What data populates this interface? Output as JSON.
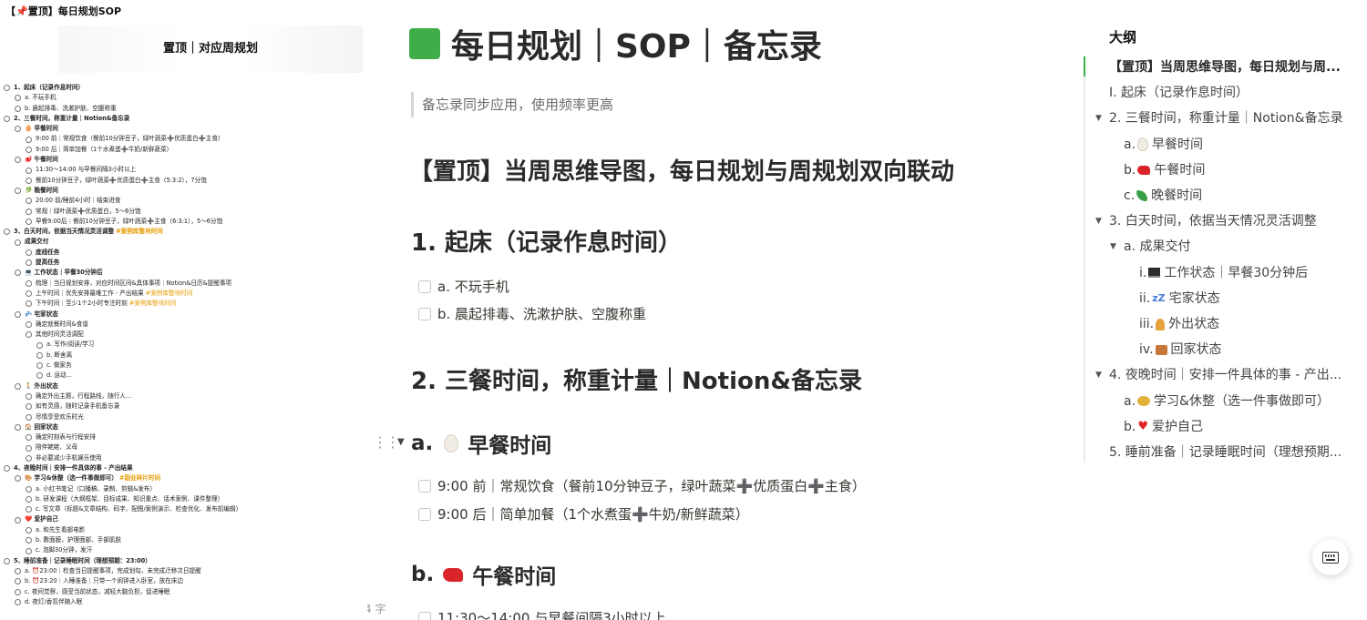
{
  "left_panel": {
    "title": "【📌置顶】每日规划SOP",
    "map_title": "置顶｜对应周规划",
    "items": [
      {
        "text": "1、起床（记录作息时间）",
        "level": 0,
        "bold": true
      },
      {
        "text": "a. 不玩手机",
        "level": 1
      },
      {
        "text": "b. 晨起排毒、洗漱护肤、空腹称重",
        "level": 1
      },
      {
        "text": "2、三餐时间，称重计量｜Notion&备忘录",
        "level": 0,
        "bold": true
      },
      {
        "text": "🥚 早餐时间",
        "level": 1,
        "bold": true
      },
      {
        "text": "9:00 前｜常规饮食（餐前10分钟豆子，绿叶蔬菜➕优质蛋白➕主食）",
        "level": 2
      },
      {
        "text": "9:00 后｜简单加餐（1个水煮蛋➕牛奶/新鲜蔬菜）",
        "level": 2
      },
      {
        "text": "🥩 午餐时间",
        "level": 1,
        "bold": true
      },
      {
        "text": "11:30～14:00 与早餐间隔3小时以上",
        "level": 2
      },
      {
        "text": "餐前10分钟豆子，绿叶蔬菜➕优质蛋白➕主食（5:3:2），7分饱",
        "level": 2
      },
      {
        "text": "🥬 晚餐时间",
        "level": 1,
        "bold": true
      },
      {
        "text": "20:00 前/睡前4小时｜结束进食",
        "level": 2
      },
      {
        "text": "常规｜绿叶蔬菜➕优质蛋白，5～6分饱",
        "level": 2
      },
      {
        "text": "早餐9:00后｜餐前10分钟豆子，绿叶蔬菜➕主食（6:3:1），5～6分饱",
        "level": 2
      },
      {
        "text": "3、白天时间，依据当天情况灵活调整",
        "level": 0,
        "bold": true,
        "tag": "#案例库整块时间"
      },
      {
        "text": "成果交付",
        "level": 1,
        "bold": true
      },
      {
        "text": "底线任务",
        "level": 2,
        "bold": true
      },
      {
        "text": "提高任务",
        "level": 2,
        "bold": true
      },
      {
        "text": "💻 工作状态｜早餐30分钟后",
        "level": 1,
        "bold": true
      },
      {
        "text": "梳理｜当日规划安排，对应时间区间&具体事项｜Notion&日历&提醒事项",
        "level": 2
      },
      {
        "text": "上午时间｜优先安排最难工作 - 产出结果",
        "level": 2,
        "tag": "#案例库整块时间"
      },
      {
        "text": "下午时间｜至少1个2小时专注时刻",
        "level": 2,
        "tag": "#案例库整块时间"
      },
      {
        "text": "💤 宅家状态",
        "level": 1,
        "bold": true
      },
      {
        "text": "确定就餐时间&食谱",
        "level": 2
      },
      {
        "text": "其他时间灵活调配",
        "level": 2
      },
      {
        "text": "a. 写作/阅读/学习",
        "level": 3
      },
      {
        "text": "b. 断舍离",
        "level": 3
      },
      {
        "text": "c. 做家务",
        "level": 3
      },
      {
        "text": "d. 运动...",
        "level": 3
      },
      {
        "text": "🚶 外出状态",
        "level": 1,
        "bold": true
      },
      {
        "text": "确定外出主题，行程路线，随行人...",
        "level": 2
      },
      {
        "text": "如有灵感，随时记录手机备忘录",
        "level": 2
      },
      {
        "text": "尽情享受欢乐时光",
        "level": 2
      },
      {
        "text": "🏠 回家状态",
        "level": 1,
        "bold": true
      },
      {
        "text": "确定时刻表与行程安排",
        "level": 2
      },
      {
        "text": "陪伴姥姥、父母",
        "level": 2
      },
      {
        "text": "非必要减少手机娱乐使用",
        "level": 2
      },
      {
        "text": "4、夜晚时间｜安排一件具体的事 - 产出结果",
        "level": 0,
        "bold": true
      },
      {
        "text": "🎨 学习&休整（选一件事做即可）",
        "level": 1,
        "bold": true,
        "tag": "#副业碎片时间"
      },
      {
        "text": "a. 小红书笔记（口播稿、录制、剪辑&发布）",
        "level": 2
      },
      {
        "text": "b. 研发课程（大纲框架、目标成果、知识重点、话术案例、课件整理）",
        "level": 2
      },
      {
        "text": "c. 写文章（标题&文章结构、码字、配图/案例演示、检查优化、发布前编辑）",
        "level": 2
      },
      {
        "text": "❤️ 爱护自己",
        "level": 1,
        "bold": true
      },
      {
        "text": "a. 和先生看部电影",
        "level": 2
      },
      {
        "text": "b. 敷面膜，护理面部、手部肌肤",
        "level": 2
      },
      {
        "text": "c. 泡脚30分钟，发汗",
        "level": 2
      },
      {
        "text": "5、睡前准备｜记录睡眠时间（理想预期：23:00）",
        "level": 0,
        "bold": true
      },
      {
        "text": "a. ⏰23:00｜检查当日提醒事项，完成划勾，未完成迁移次日提醒",
        "level": 1
      },
      {
        "text": "b. ⏰23:20｜入睡准备｜只带一个闹钟进入卧室，放在床边",
        "level": 1
      },
      {
        "text": "c. 夜间觉察，感受当前状态，减轻大脑负担，促进睡眠",
        "level": 1
      },
      {
        "text": "d. 夜灯/香氛伴随入眠",
        "level": 1
      }
    ]
  },
  "page": {
    "title": "每日规划｜SOP｜备忘录",
    "quote": "备忘录同步应用，使用频率更高",
    "heading_pinned": "【置顶】当周思维导图，每日规划与周规划双向联动",
    "heading_1": "1. 起床（记录作息时间）",
    "todo_1a": "a. 不玩手机",
    "todo_1b": "b. 晨起排毒、洗漱护肤、空腹称重",
    "heading_2": "2. 三餐时间，称重计量｜Notion&备忘录",
    "breakfast_prefix": "a.",
    "breakfast_label": "早餐时间",
    "todo_breakfast_1": "9:00 前｜常规饮食（餐前10分钟豆子，绿叶蔬菜➕优质蛋白➕主食）",
    "todo_breakfast_2": "9:00 后｜简单加餐（1个水煮蛋➕牛奶/新鲜蔬菜）",
    "lunch_prefix": "b.",
    "lunch_label": "午餐时间",
    "todo_lunch_1": "11:30～14:00 与早餐间隔3小时以上",
    "word_count": "4 字"
  },
  "outline": {
    "label": "大纲",
    "items": [
      {
        "text": "【置顶】当周思维导图，每日规划与周...",
        "indent": 0,
        "active": true
      },
      {
        "text": "I. 起床（记录作息时间）",
        "indent": 0
      },
      {
        "text": "2. 三餐时间，称重计量｜Notion&备忘录",
        "indent": 0,
        "toggle": true
      },
      {
        "text": "早餐时间",
        "prefix": "a.",
        "icon": "egg",
        "indent": 1
      },
      {
        "text": "午餐时间",
        "prefix": "b.",
        "icon": "meat",
        "indent": 1
      },
      {
        "text": "晚餐时间",
        "prefix": "c.",
        "icon": "leaf",
        "indent": 1
      },
      {
        "text": "3. 白天时间，依据当天情况灵活调整",
        "indent": 0,
        "toggle": true
      },
      {
        "text": "a. 成果交付",
        "indent": 1,
        "toggle": true
      },
      {
        "text": "工作状态｜早餐30分钟后",
        "prefix": "i.",
        "icon": "pc",
        "indent": 2
      },
      {
        "text": "宅家状态",
        "prefix": "ii.",
        "icon": "zz",
        "indent": 2
      },
      {
        "text": "外出状态",
        "prefix": "iii.",
        "icon": "per",
        "indent": 2
      },
      {
        "text": "回家状态",
        "prefix": "iv.",
        "icon": "house",
        "indent": 2
      },
      {
        "text": "4. 夜晚时间｜安排一件具体的事 - 产出...",
        "indent": 0,
        "toggle": true
      },
      {
        "text": "学习&休整（选一件事做即可）",
        "prefix": "a.",
        "icon": "palette",
        "indent": 1
      },
      {
        "text": "爱护自己",
        "prefix": "b.",
        "icon": "heart",
        "indent": 1
      },
      {
        "text": "5. 睡前准备｜记录睡眠时间（理想预期...",
        "indent": 0
      }
    ]
  },
  "icons": {
    "page_icon": "green-square-icon",
    "keyboard": "keyboard-icon"
  },
  "colors": {
    "accent_green": "#3fae49",
    "tag_orange": "#e69b00"
  }
}
